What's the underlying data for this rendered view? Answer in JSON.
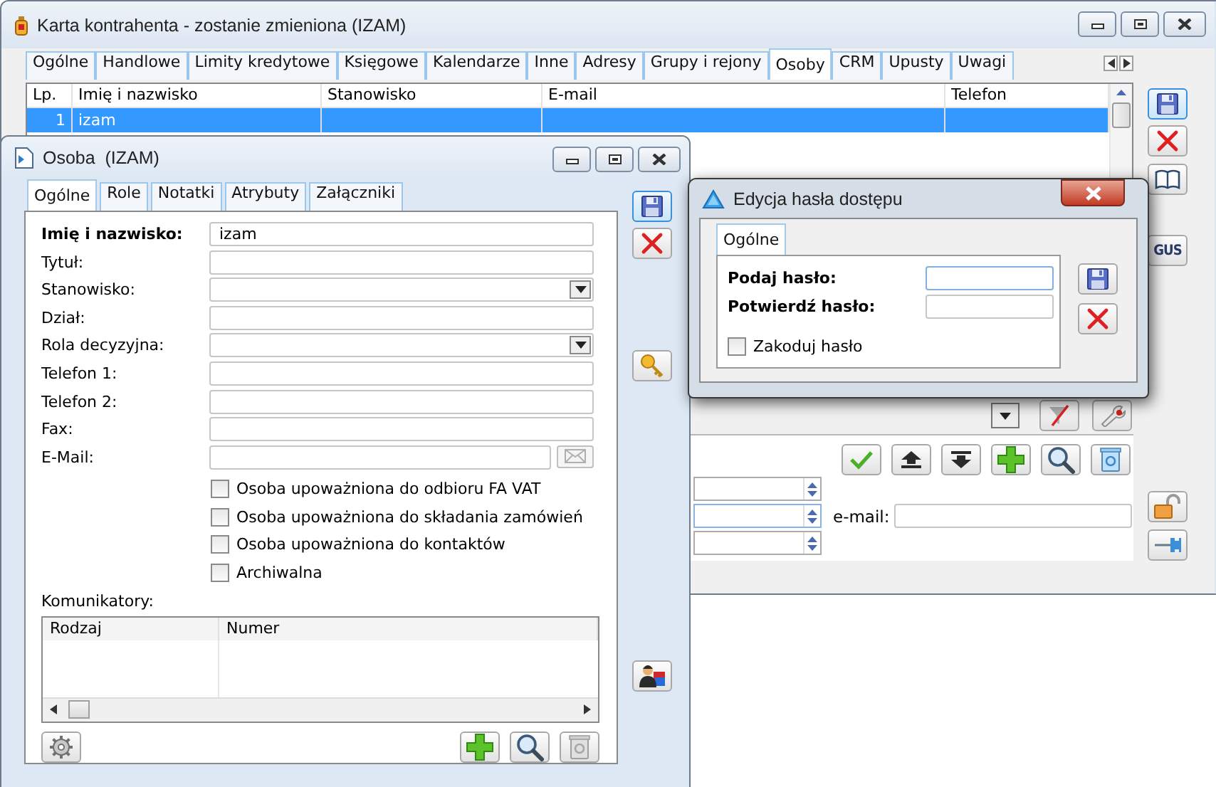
{
  "main_window": {
    "title": "Karta kontrahenta - zostanie zmieniona (IZAM)",
    "tabs": [
      {
        "label": "Ogólne",
        "selected": false
      },
      {
        "label": "Handlowe",
        "selected": false
      },
      {
        "label": "Limity kredytowe",
        "selected": false
      },
      {
        "label": "Księgowe",
        "selected": false
      },
      {
        "label": "Kalendarze",
        "selected": false
      },
      {
        "label": "Inne",
        "selected": false
      },
      {
        "label": "Adresy",
        "selected": false
      },
      {
        "label": "Grupy i rejony",
        "selected": false
      },
      {
        "label": "Osoby",
        "selected": true
      },
      {
        "label": "CRM",
        "selected": false
      },
      {
        "label": "Upusty",
        "selected": false
      },
      {
        "label": "Uwagi",
        "selected": false
      }
    ],
    "table": {
      "columns": [
        "Lp.",
        "Imię i nazwisko",
        "Stanowisko",
        "E-mail",
        "Telefon"
      ],
      "rows": [
        {
          "lp": "1",
          "name": "izam",
          "selected": true
        }
      ]
    },
    "gus_button": "GUS",
    "email_label": "e-mail:"
  },
  "person_window": {
    "title": "Osoba  (IZAM)",
    "tabs": [
      {
        "label": "Ogólne",
        "selected": true
      },
      {
        "label": "Role",
        "selected": false
      },
      {
        "label": "Notatki",
        "selected": false
      },
      {
        "label": "Atrybuty",
        "selected": false
      },
      {
        "label": "Załączniki",
        "selected": false
      }
    ],
    "fields": [
      {
        "label": "Imię i nazwisko:",
        "kind": "text",
        "required": true,
        "value": "izam"
      },
      {
        "label": "Tytuł:",
        "kind": "text",
        "required": false
      },
      {
        "label": "Stanowisko:",
        "kind": "combo",
        "required": false
      },
      {
        "label": "Dział:",
        "kind": "text",
        "required": false
      },
      {
        "label": "Rola decyzyjna:",
        "kind": "combo",
        "required": false
      },
      {
        "label": "Telefon 1:",
        "kind": "text",
        "required": false
      },
      {
        "label": "Telefon 2:",
        "kind": "text",
        "required": false
      },
      {
        "label": "Fax:",
        "kind": "text",
        "required": false
      },
      {
        "label": "E-Mail:",
        "kind": "email",
        "required": false
      }
    ],
    "checkboxes": [
      {
        "label": "Osoba upoważniona do odbioru FA VAT",
        "checked": false
      },
      {
        "label": "Osoba upoważniona do składania zamówień",
        "checked": false
      },
      {
        "label": "Osoba upoważniona do kontaktów",
        "checked": false
      },
      {
        "label": "Archiwalna",
        "checked": false
      }
    ],
    "messengers": {
      "label": "Komunikatory:",
      "columns": [
        "Rodzaj",
        "Numer"
      ]
    }
  },
  "password_window": {
    "title": "Edycja hasła dostępu",
    "tabs": [
      {
        "label": "Ogólne",
        "selected": true
      }
    ],
    "fields": [
      {
        "label": "Podaj hasło:",
        "focused": true
      },
      {
        "label": "Potwierdź hasło:",
        "focused": false
      }
    ],
    "checkbox": {
      "label": "Zakoduj hasło",
      "checked": false
    }
  }
}
